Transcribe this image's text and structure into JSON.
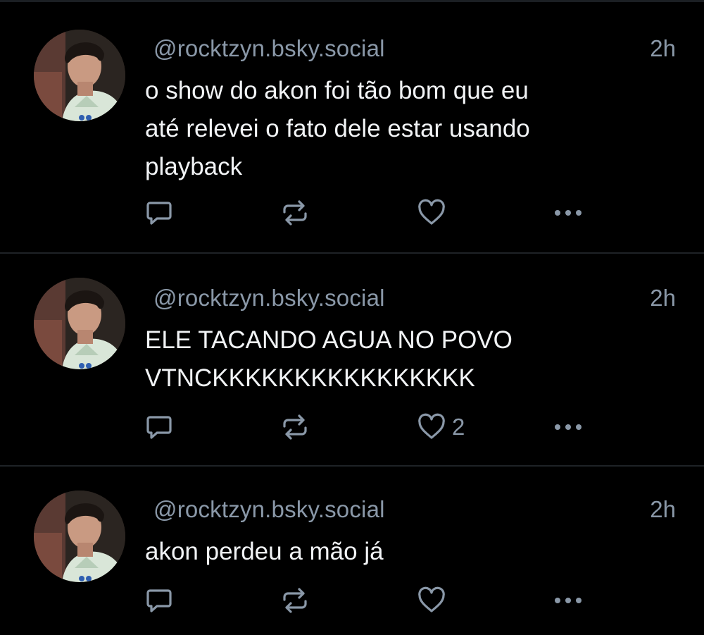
{
  "feed": {
    "posts": [
      {
        "handle": "@rocktzyn.bsky.social",
        "time": "2h",
        "text": "o show do akon foi tão bom que eu\naté relevei o fato dele estar usando\nplayback",
        "like_count": "",
        "icons": {
          "reply": "reply-icon",
          "repost": "repost-icon",
          "like": "heart-icon",
          "more": "more-icon"
        }
      },
      {
        "handle": "@rocktzyn.bsky.social",
        "time": "2h",
        "text": "ELE TACANDO AGUA NO POVO\nVTNCKKKKKKKKKKKKKKKK",
        "like_count": "2",
        "icons": {
          "reply": "reply-icon",
          "repost": "repost-icon",
          "like": "heart-icon",
          "more": "more-icon"
        }
      },
      {
        "handle": "@rocktzyn.bsky.social",
        "time": "2h",
        "text": "akon perdeu a mão já",
        "like_count": "",
        "icons": {
          "reply": "reply-icon",
          "repost": "repost-icon",
          "like": "heart-icon",
          "more": "more-icon"
        }
      }
    ]
  },
  "colors": {
    "background": "#000000",
    "text_primary": "#f1f3f5",
    "text_secondary": "#8a98a8",
    "divider": "#1e2226"
  }
}
